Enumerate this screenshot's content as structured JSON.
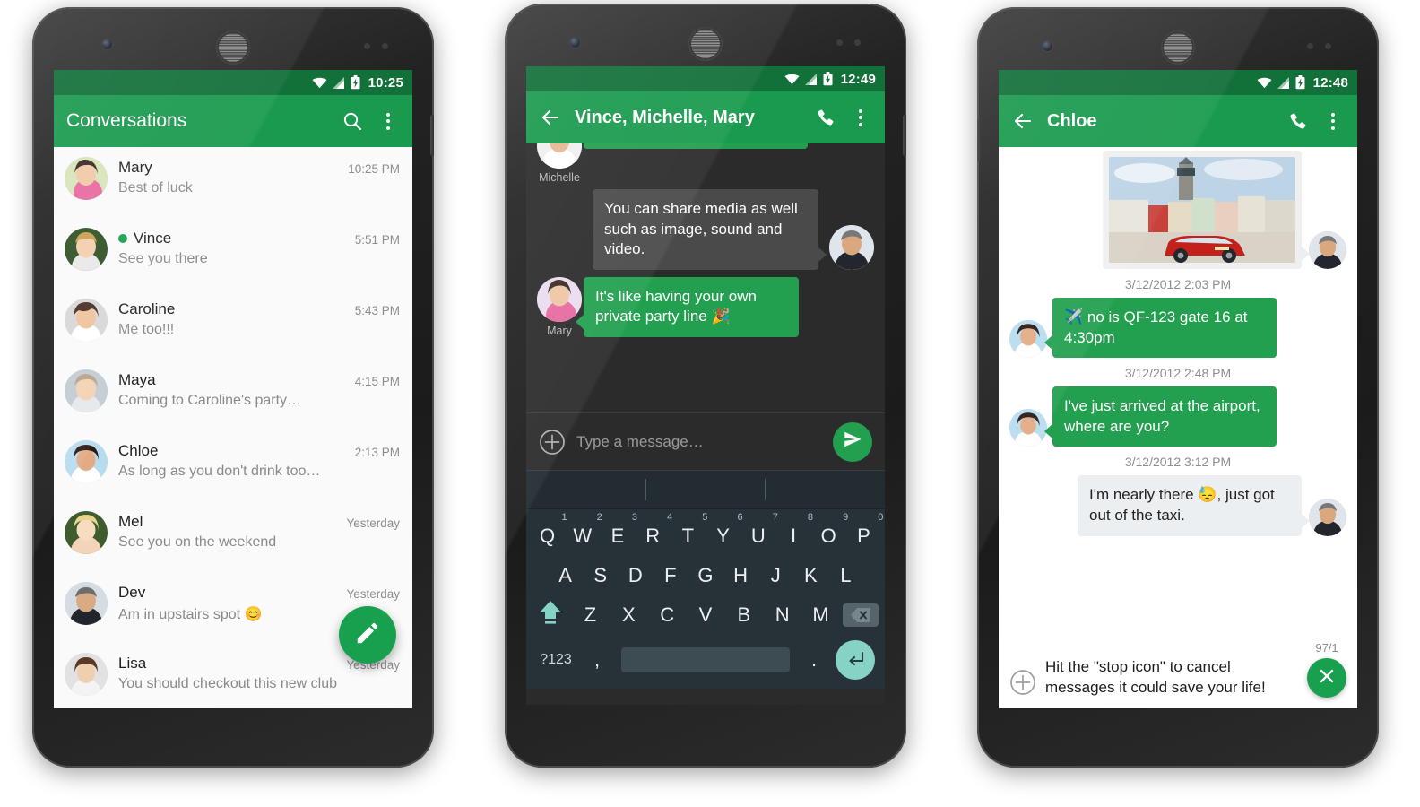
{
  "phones": [
    {
      "id": "phone-conversations",
      "status_bar": {
        "time": "10:25",
        "icons": [
          "wifi-icon",
          "signal-icon",
          "battery-charging-icon"
        ]
      },
      "app_bar": {
        "title": "Conversations",
        "actions": [
          "search-icon",
          "overflow-menu-icon"
        ]
      },
      "conversations": [
        {
          "name": "Mary",
          "time": "10:25 PM",
          "preview": "Best of luck",
          "unread": false
        },
        {
          "name": "Vince",
          "time": "5:51 PM",
          "preview": "See you there",
          "unread": true
        },
        {
          "name": "Caroline",
          "time": "5:43 PM",
          "preview": "Me too!!!",
          "unread": false
        },
        {
          "name": "Maya",
          "time": "4:15 PM",
          "preview": "Coming to Caroline's party…",
          "unread": false
        },
        {
          "name": "Chloe",
          "time": "2:13 PM",
          "preview": "As long as you don't drink too…",
          "unread": false
        },
        {
          "name": "Mel",
          "time": "Yesterday",
          "preview": "See you on the weekend",
          "unread": false
        },
        {
          "name": "Dev",
          "time": "Yesterday",
          "preview": "Am in upstairs spot 😊",
          "unread": false
        },
        {
          "name": "Lisa",
          "time": "Yesterday",
          "preview": "You should checkout this new club",
          "unread": false
        }
      ],
      "fab": {
        "icon": "compose-pencil-icon",
        "label": "New message"
      }
    },
    {
      "id": "phone-group-chat",
      "status_bar": {
        "time": "12:49",
        "icons": [
          "wifi-icon",
          "signal-icon",
          "battery-charging-icon"
        ]
      },
      "app_bar": {
        "back": "back-arrow-icon",
        "title": "Vince, Michelle, Mary",
        "actions": [
          "call-icon",
          "overflow-menu-icon"
        ]
      },
      "messages": [
        {
          "side": "left",
          "sender": "Michelle",
          "style": "green",
          "text": "",
          "clipped": true
        },
        {
          "side": "right",
          "sender": "",
          "style": "grey-dark",
          "text": "You can share media as well such as image, sound and video."
        },
        {
          "side": "left",
          "sender": "Mary",
          "style": "green",
          "text": "It's like having your own private party line 🎉"
        }
      ],
      "composer": {
        "attach": "plus-circle-icon",
        "placeholder": "Type a message…",
        "send": "send-icon"
      },
      "keyboard": {
        "rows": [
          [
            {
              "k": "Q",
              "n": "1"
            },
            {
              "k": "W",
              "n": "2"
            },
            {
              "k": "E",
              "n": "3"
            },
            {
              "k": "R",
              "n": "4"
            },
            {
              "k": "T",
              "n": "5"
            },
            {
              "k": "Y",
              "n": "6"
            },
            {
              "k": "U",
              "n": "7"
            },
            {
              "k": "I",
              "n": "8"
            },
            {
              "k": "O",
              "n": "9"
            },
            {
              "k": "P",
              "n": "0"
            }
          ],
          [
            {
              "k": "A"
            },
            {
              "k": "S"
            },
            {
              "k": "D"
            },
            {
              "k": "F"
            },
            {
              "k": "G"
            },
            {
              "k": "H"
            },
            {
              "k": "J"
            },
            {
              "k": "K"
            },
            {
              "k": "L"
            }
          ],
          [
            {
              "k": "Z"
            },
            {
              "k": "X"
            },
            {
              "k": "C"
            },
            {
              "k": "V"
            },
            {
              "k": "B"
            },
            {
              "k": "N"
            },
            {
              "k": "M"
            }
          ]
        ],
        "shift": "shift-icon",
        "backspace": "backspace-icon",
        "symbols": "?123",
        "comma": ",",
        "period": ".",
        "enter": "enter-icon"
      }
    },
    {
      "id": "phone-chloe-chat",
      "status_bar": {
        "time": "12:48",
        "icons": [
          "wifi-icon",
          "signal-icon",
          "battery-charging-icon"
        ]
      },
      "app_bar": {
        "back": "back-arrow-icon",
        "title": "Chloe",
        "actions": [
          "call-icon",
          "overflow-menu-icon"
        ]
      },
      "messages": [
        {
          "type": "image",
          "side": "right",
          "alt": "red car in old town square"
        },
        {
          "type": "timestamp",
          "text": "3/12/2012 2:03 PM"
        },
        {
          "type": "text",
          "side": "left",
          "style": "green",
          "text": "✈️ no is QF-123 gate 16 at 4:30pm"
        },
        {
          "type": "timestamp",
          "text": "3/12/2012 2:48 PM"
        },
        {
          "type": "text",
          "side": "left",
          "style": "green",
          "text": "I've just arrived at the airport, where are you?"
        },
        {
          "type": "timestamp",
          "text": "3/12/2012 3:12 PM"
        },
        {
          "type": "text",
          "side": "right",
          "style": "grey-light",
          "text": "I'm nearly there 😓, just got out of the taxi."
        }
      ],
      "composer": {
        "attach": "plus-circle-icon",
        "draft": "Hit the \"stop icon\" to cancel messages it could save your life!",
        "counter": "97/1",
        "stop": "stop-x-icon"
      }
    }
  ],
  "colors": {
    "status_bar_green": "#127039",
    "app_bar_green": "#1a9a4e",
    "bubble_green": "#22a04f",
    "bubble_grey_dark": "#4a4a4a",
    "bubble_grey_light": "#eceff1",
    "chat_dark_bg": "#2b2b2b",
    "keyboard_bg": "#263238",
    "enter_key": "#86d3c6"
  }
}
